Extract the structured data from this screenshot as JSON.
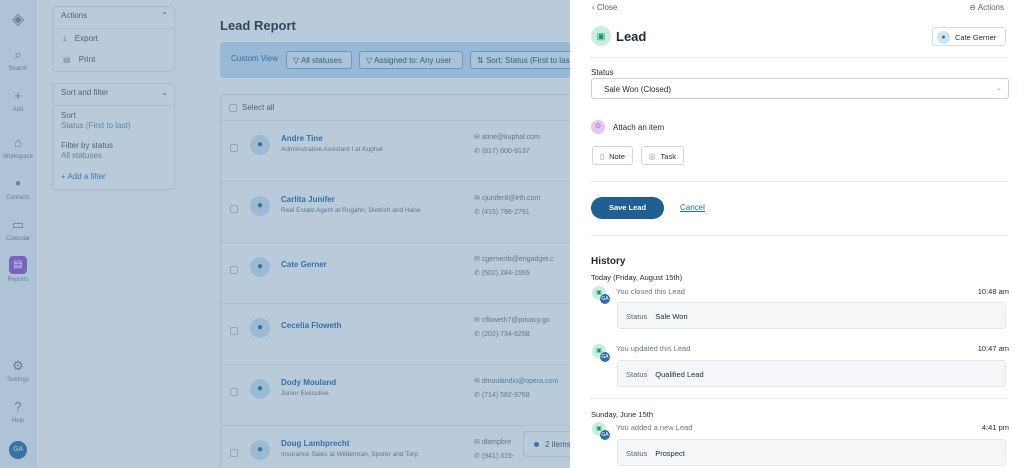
{
  "rail": {
    "items": [
      {
        "label": "Search",
        "icon": "search-icon",
        "glyph": "⌕"
      },
      {
        "label": "Add",
        "icon": "plus-icon",
        "glyph": "+"
      },
      {
        "label": "Workspace",
        "icon": "home-icon",
        "glyph": "⌂"
      },
      {
        "label": "Contacts",
        "icon": "person-icon",
        "glyph": "👤"
      },
      {
        "label": "Calendar",
        "icon": "calendar-icon",
        "glyph": "▭"
      },
      {
        "label": "Reports",
        "icon": "reports-icon",
        "glyph": "▤"
      },
      {
        "label": "Settings",
        "icon": "gear-icon",
        "glyph": "⚙"
      },
      {
        "label": "Help",
        "icon": "help-icon",
        "glyph": "?"
      }
    ],
    "avatar": "GA"
  },
  "actions_panel": {
    "title": "Actions",
    "export": "Export",
    "print": "Print"
  },
  "sort_filter": {
    "title": "Sort and filter",
    "sort_label": "Sort",
    "sort_value": "Status (First to last)",
    "filter_label": "Filter by status",
    "filter_value": "All statuses",
    "add_filter": "+ Add a filter"
  },
  "main": {
    "title": "Lead Report",
    "custom_view": "Custom View",
    "chip_statuses": "All statuses",
    "chip_assigned": "Assigned to: Any user",
    "chip_sort": "Sort: Status (First to last)",
    "select_all": "Select all",
    "selected_pill": "2 items"
  },
  "leads": [
    {
      "name": "Andre Tine",
      "title": "Administrative Assistant I at Kuphal",
      "email": "atine@kuphal.com",
      "phone": "(817) 600-9137"
    },
    {
      "name": "Carlita Junifer",
      "title": "Real Estate Agent at Rogahn, Dietrich and Hane",
      "email": "cjunifer8@irth.com",
      "phone": "(415) 796-2791"
    },
    {
      "name": "Cate Gerner",
      "title": "",
      "email": "cgernerrb@engadget.c",
      "phone": "(502) 284-1555"
    },
    {
      "name": "Cecelia Floweth",
      "title": "",
      "email": "cfloweth7@privacy.go",
      "phone": "(202) 734-6258"
    },
    {
      "name": "Dody Mouland",
      "title": "Junior Executive",
      "email": "dmoulandio@opera.com",
      "phone": "(714) 582-9768"
    },
    {
      "name": "Doug Lambprecht",
      "title": "Insurance Sales at Wilderman, Sporer and Torp",
      "email": "dlampbre",
      "phone": "(941) 315-"
    }
  ],
  "drawer": {
    "close": "‹ Close",
    "actions": "⊖ Actions",
    "title": "Lead",
    "owner": "Cate Gerner",
    "status_label": "Status",
    "status_value": "Sale Won (Closed)",
    "attach_label": "Attach an item",
    "note_btn": "Note",
    "task_btn": "Task",
    "save_btn": "Save Lead",
    "cancel_btn": "Cancel",
    "history_title": "History"
  },
  "history": [
    {
      "day": "Today (Friday, August 15th)",
      "text": "You closed this Lead",
      "time": "10:48 am",
      "box_label": "Status",
      "box_value": "Sale Won"
    },
    {
      "day": "",
      "text": "You updated this Lead",
      "time": "10:47 am",
      "box_label": "Status",
      "box_value": "Qualified Lead"
    },
    {
      "day": "Sunday, June 15th",
      "text": "You added a new Lead",
      "time": "4:41 pm",
      "box_label": "Status",
      "box_value": "Prospect"
    }
  ]
}
